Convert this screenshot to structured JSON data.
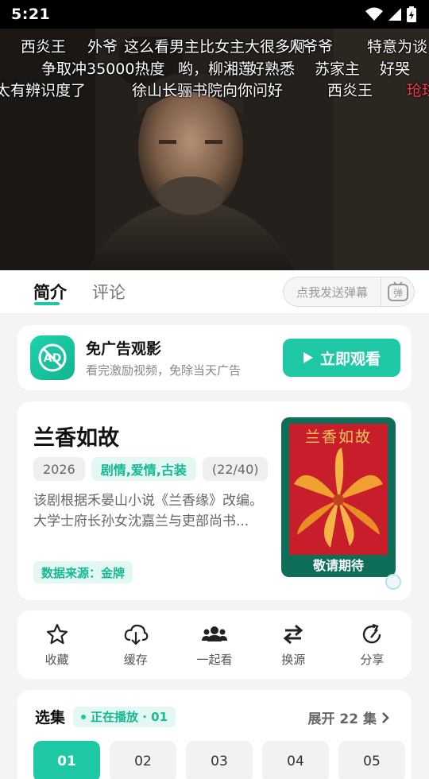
{
  "status_bar": {
    "time": "5:21"
  },
  "danmaku": [
    {
      "text": "西炎王",
      "color": "white"
    },
    {
      "text": "外爷",
      "color": "white"
    },
    {
      "text": "这么看男主比女主大很多啊",
      "color": "white"
    },
    {
      "text": "人爷爷",
      "color": "white"
    },
    {
      "text": "特意为谈",
      "color": "white"
    },
    {
      "text": "争取冲35000热度",
      "color": "white"
    },
    {
      "text": "哟，柳湘莲",
      "color": "white"
    },
    {
      "text": "好熟悉",
      "color": "white"
    },
    {
      "text": "苏家主",
      "color": "white"
    },
    {
      "text": "好哭",
      "color": "white"
    },
    {
      "text": "太有辨识度了",
      "color": "white"
    },
    {
      "text": "徐山长骊书院向你问好",
      "color": "white"
    },
    {
      "text": "西炎王",
      "color": "white"
    },
    {
      "text": "玱玹",
      "color": "red"
    }
  ],
  "tabs": {
    "intro": "简介",
    "comments": "评论",
    "danmu_placeholder": "点我发送弹幕",
    "danmu_button": "弹"
  },
  "ad": {
    "icon_text": "AD",
    "title": "免广告观影",
    "subtitle": "看完激励视频，免除当天广告",
    "button": "立即观看"
  },
  "show": {
    "title": "兰香如故",
    "year": "2026",
    "genre": "剧情,爱情,古装",
    "episodes": "(22/40)",
    "description_line1": "该剧根据禾晏山小说《兰香缘》改编。",
    "description_line2": "大学士府长孙女沈嘉兰与吏部尚书...",
    "source": "数据来源：金牌",
    "poster_title": "兰香如故",
    "poster_footer": "敬请期待"
  },
  "actions": [
    {
      "label": "收藏",
      "icon": "star-icon"
    },
    {
      "label": "缓存",
      "icon": "download-icon"
    },
    {
      "label": "一起看",
      "icon": "group-icon"
    },
    {
      "label": "换源",
      "icon": "swap-icon"
    },
    {
      "label": "分享",
      "icon": "share-icon"
    }
  ],
  "episodes_section": {
    "title": "选集",
    "playing": "正在播放 · 01",
    "expand": "展开 22 集",
    "list": [
      "01",
      "02",
      "03",
      "04",
      "05"
    ],
    "active": "01"
  },
  "colors": {
    "accent": "#1ec8a5",
    "danmaku_red": "#ff3a55"
  }
}
